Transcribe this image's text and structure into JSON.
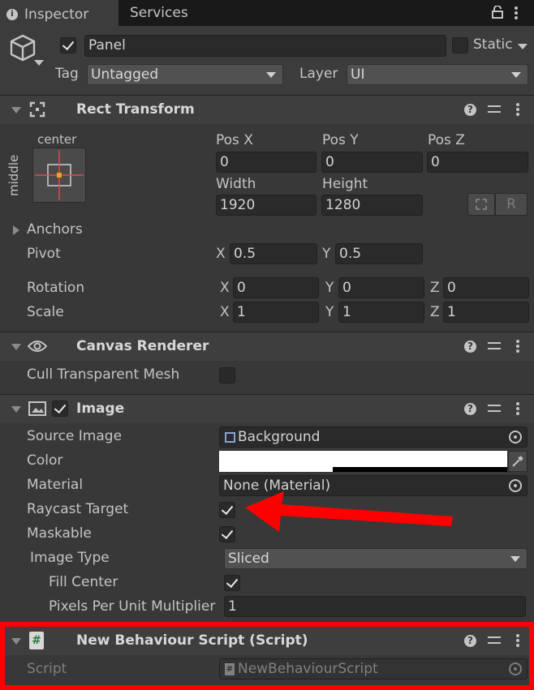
{
  "tabs": [
    {
      "label": "Inspector",
      "icon": "info-icon"
    },
    {
      "label": "Services"
    }
  ],
  "object": {
    "name": "Panel",
    "active": true,
    "static_label": "Static",
    "tag_label": "Tag",
    "tag_value": "Untagged",
    "layer_label": "Layer",
    "layer_value": "UI"
  },
  "rect_transform": {
    "title": "Rect Transform",
    "anchor_h": "center",
    "anchor_v": "middle",
    "pos_x_label": "Pos X",
    "pos_x": "0",
    "pos_y_label": "Pos Y",
    "pos_y": "0",
    "pos_z_label": "Pos Z",
    "pos_z": "0",
    "width_label": "Width",
    "width": "1920",
    "height_label": "Height",
    "height": "1280",
    "raw_button": "R",
    "anchors_label": "Anchors",
    "pivot_label": "Pivot",
    "pivot_x": "0.5",
    "pivot_y": "0.5",
    "rotation_label": "Rotation",
    "rot_x": "0",
    "rot_y": "0",
    "rot_z": "0",
    "scale_label": "Scale",
    "scale_x": "1",
    "scale_y": "1",
    "scale_z": "1",
    "x": "X",
    "y": "Y",
    "z": "Z"
  },
  "canvas_renderer": {
    "title": "Canvas Renderer",
    "cull_label": "Cull Transparent Mesh",
    "cull_value": false
  },
  "image": {
    "title": "Image",
    "enabled": true,
    "source_label": "Source Image",
    "source_value": "Background",
    "color_label": "Color",
    "color_value": "#ffffff",
    "material_label": "Material",
    "material_value": "None (Material)",
    "raycast_label": "Raycast Target",
    "raycast_value": true,
    "maskable_label": "Maskable",
    "maskable_value": true,
    "image_type_label": "Image Type",
    "image_type_value": "Sliced",
    "fill_center_label": "Fill Center",
    "fill_center_value": true,
    "ppu_label": "Pixels Per Unit Multiplier",
    "ppu_value": "1"
  },
  "script_component": {
    "title": "New Behaviour Script (Script)",
    "script_label": "Script",
    "script_value": "NewBehaviourScript"
  },
  "colors": {
    "background": "#383838",
    "field": "#2a2a2a",
    "annotation": "#ff0000"
  }
}
